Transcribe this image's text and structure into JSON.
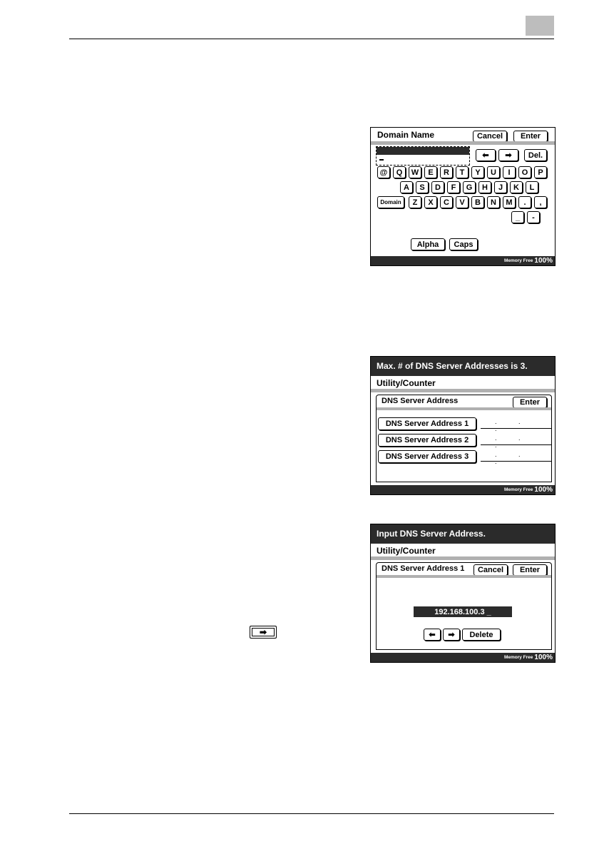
{
  "panel1": {
    "title": "Domain Name",
    "cancel": "Cancel",
    "enter": "Enter",
    "left_arrow": "⬅",
    "right_arrow": "➡",
    "del": "Del.",
    "row1": [
      "@",
      "Q",
      "W",
      "E",
      "R",
      "T",
      "Y",
      "U",
      "I",
      "O",
      "P"
    ],
    "row2": [
      "A",
      "S",
      "D",
      "F",
      "G",
      "H",
      "J",
      "K",
      "L"
    ],
    "domain_key": "Domain",
    "row3": [
      "Z",
      "X",
      "C",
      "V",
      "B",
      "N",
      "M",
      ".",
      ","
    ],
    "row4": [
      "_",
      "-"
    ],
    "alpha": "Alpha",
    "caps": "Caps",
    "memory_label": "Memory Free",
    "memory_value": "100%"
  },
  "panel2": {
    "message": "Max. # of DNS Server Addresses is 3.",
    "util": "Utility/Counter",
    "subtitle": "DNS Server Address",
    "enter": "Enter",
    "addresses": [
      "DNS Server Address 1",
      "DNS Server Address 2",
      "DNS Server Address 3"
    ],
    "dots": ". . .",
    "memory_label": "Memory Free",
    "memory_value": "100%"
  },
  "panel3": {
    "message": "Input DNS Server Address.",
    "util": "Utility/Counter",
    "subtitle": "DNS Server Address 1",
    "cancel": "Cancel",
    "enter": "Enter",
    "ip_value": "192.168.100.3 _",
    "left_arrow": "⬅",
    "right_arrow": "➡",
    "delete": "Delete",
    "memory_label": "Memory Free",
    "memory_value": "100%"
  },
  "inline_icon": "right-arrow-icon",
  "inline_arrow": "➡"
}
